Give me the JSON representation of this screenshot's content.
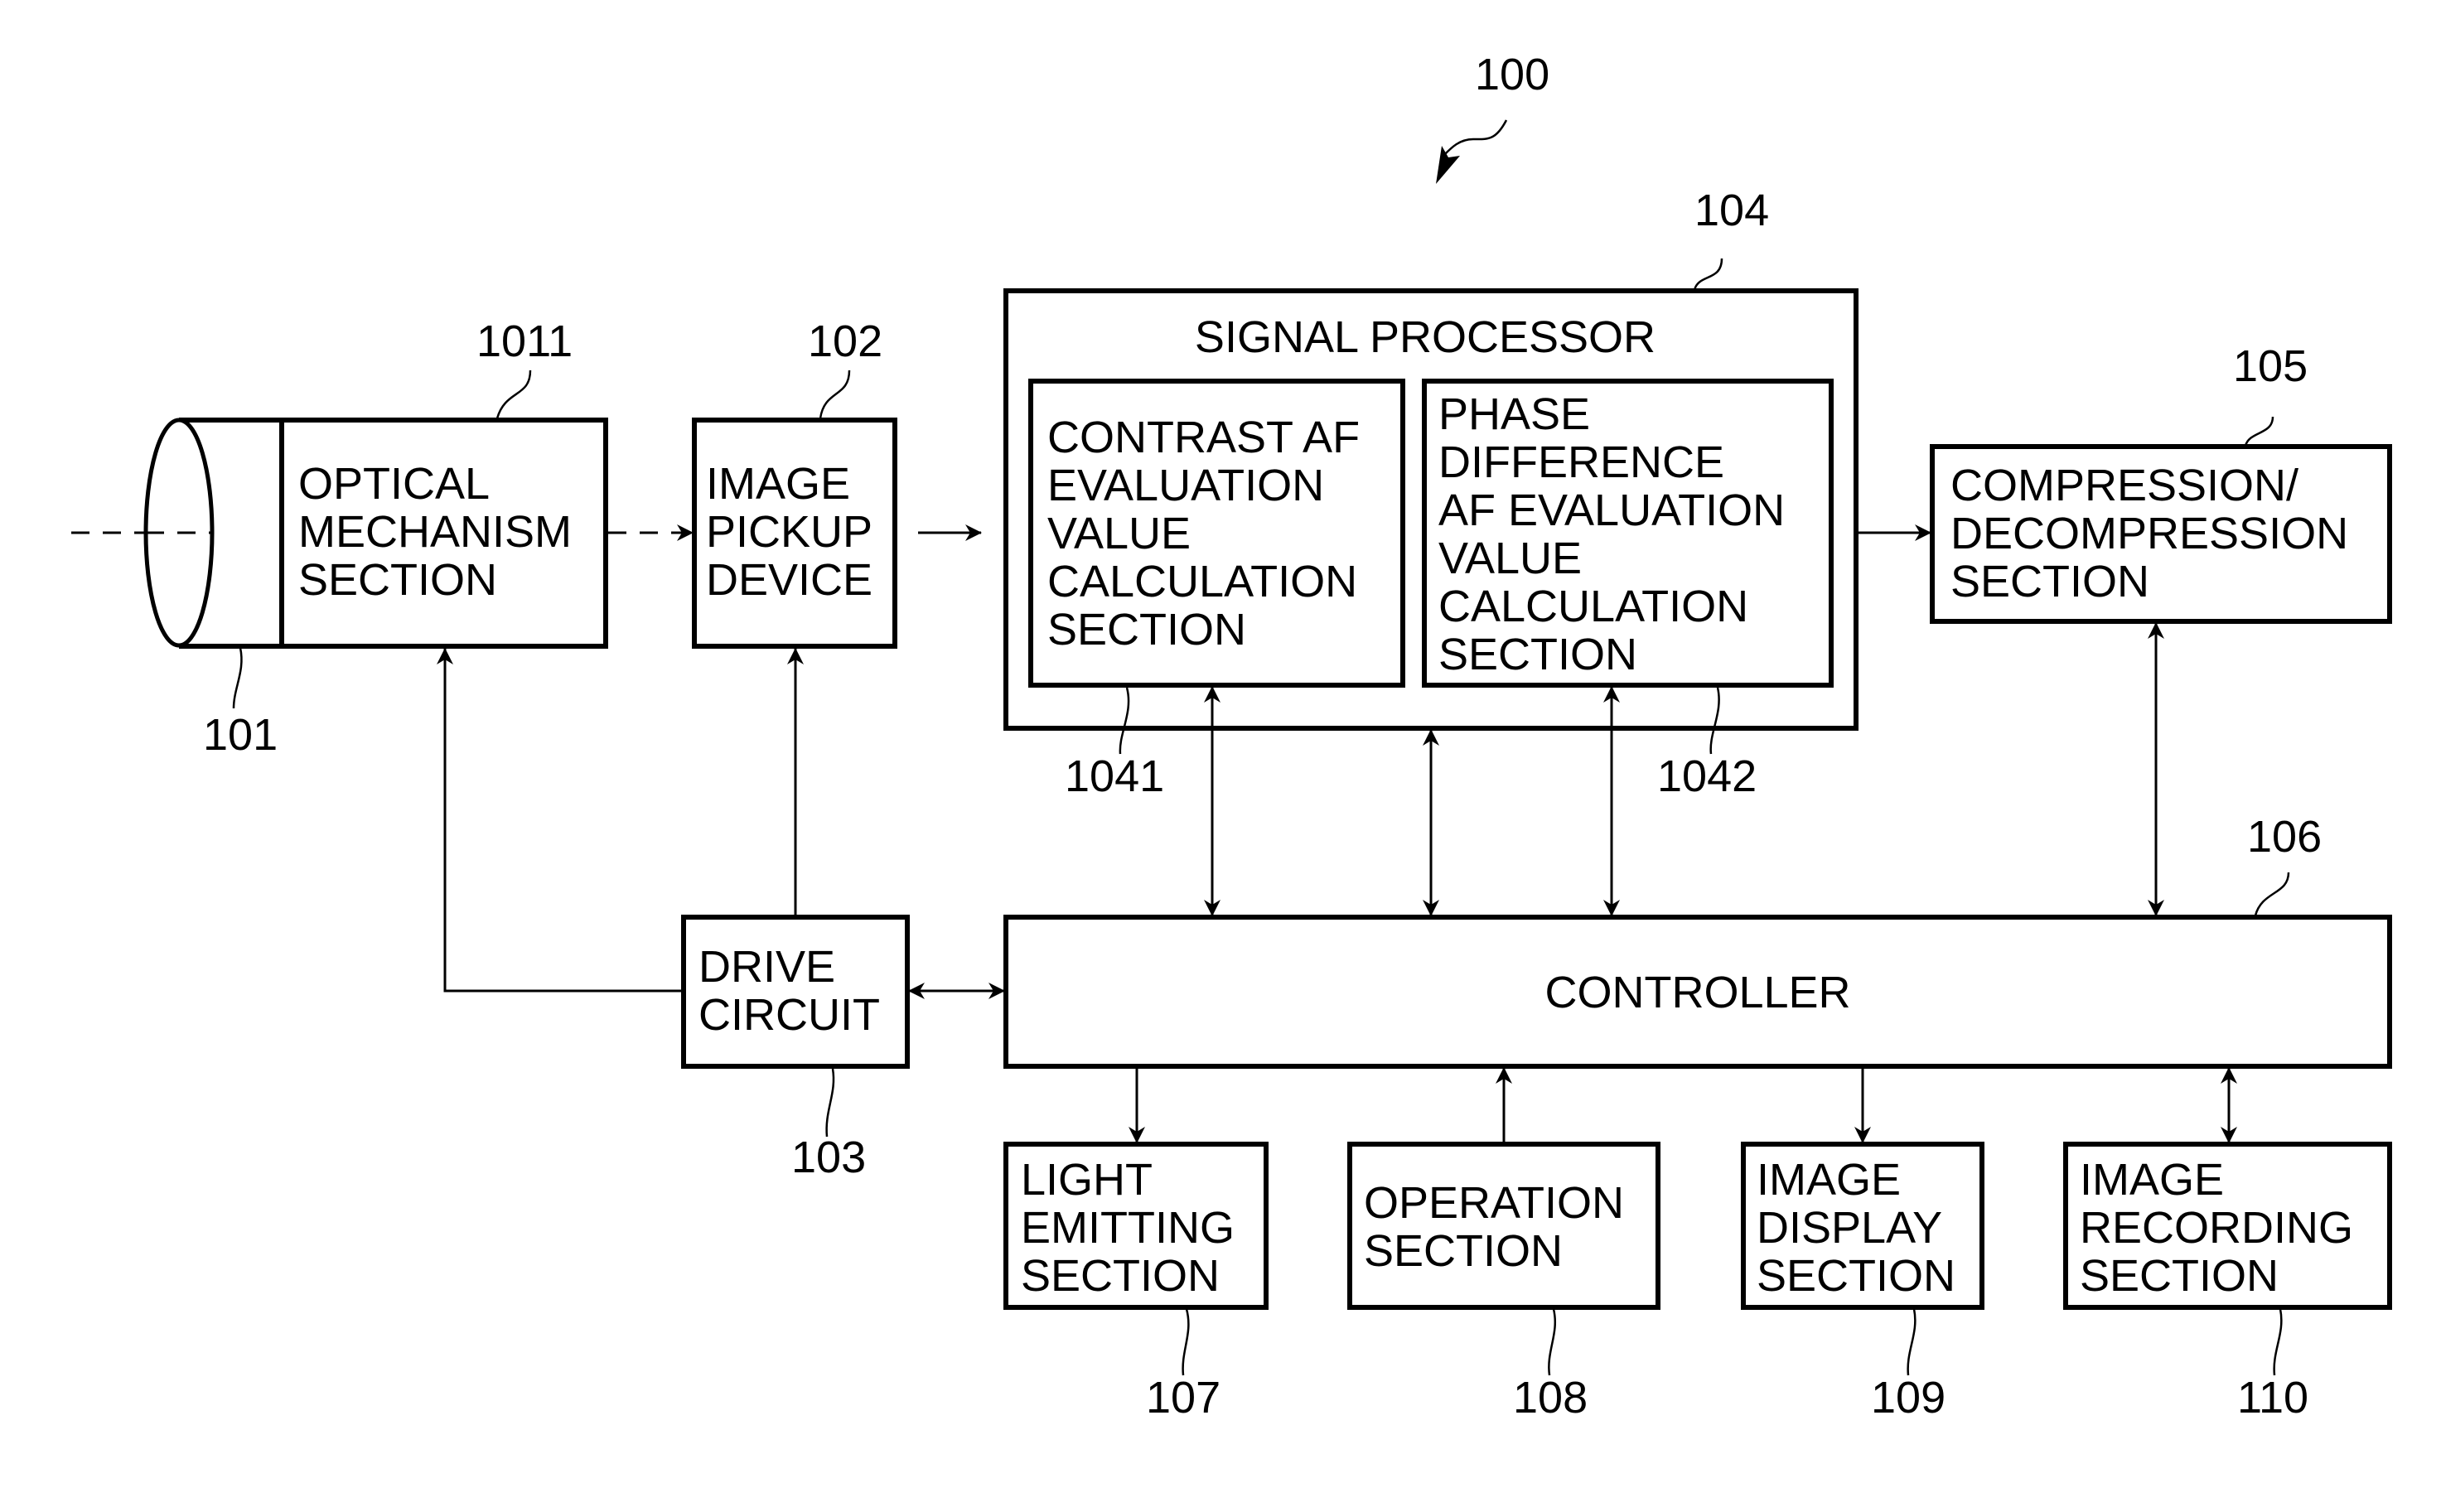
{
  "figure": {
    "ref": "100",
    "blocks": {
      "lens": {
        "ref": "101"
      },
      "optical": {
        "ref": "1011",
        "lines": [
          "OPTICAL",
          "MECHANISM",
          "SECTION"
        ]
      },
      "pickup": {
        "ref": "102",
        "lines": [
          "IMAGE",
          "PICKUP",
          "DEVICE"
        ]
      },
      "drive": {
        "ref": "103",
        "lines": [
          "DRIVE",
          "CIRCUIT"
        ]
      },
      "signal": {
        "ref": "104",
        "title": "SIGNAL PROCESSOR"
      },
      "contrast": {
        "ref": "1041",
        "lines": [
          "CONTRAST AF",
          "EVALUATION",
          "VALUE",
          "CALCULATION",
          "SECTION"
        ]
      },
      "phase": {
        "ref": "1042",
        "lines": [
          "PHASE",
          "DIFFERENCE",
          "AF EVALUATION",
          "VALUE",
          "CALCULATION",
          "SECTION"
        ]
      },
      "compression": {
        "ref": "105",
        "lines": [
          "COMPRESSION/",
          "DECOMPRESSION",
          "SECTION"
        ]
      },
      "controller": {
        "ref": "106",
        "title": "CONTROLLER"
      },
      "light": {
        "ref": "107",
        "lines": [
          "LIGHT",
          "EMITTING",
          "SECTION"
        ]
      },
      "operation": {
        "ref": "108",
        "lines": [
          "OPERATION",
          "SECTION"
        ]
      },
      "display": {
        "ref": "109",
        "lines": [
          "IMAGE",
          "DISPLAY",
          "SECTION"
        ]
      },
      "recording": {
        "ref": "110",
        "lines": [
          "IMAGE",
          "RECORDING",
          "SECTION"
        ]
      }
    }
  }
}
